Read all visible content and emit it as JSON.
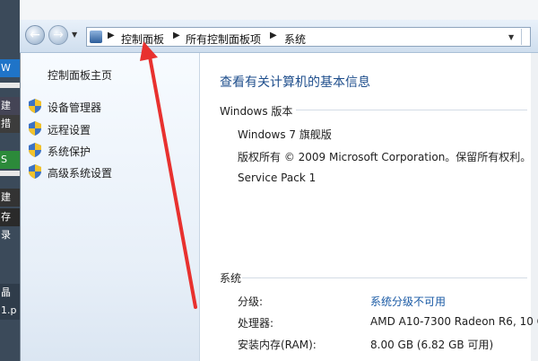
{
  "window": {
    "breadcrumb": [
      "控制面板",
      "所有控制面板项",
      "系统"
    ]
  },
  "sidebar": {
    "home": "控制面板主页",
    "links": [
      "设备管理器",
      "远程设置",
      "系统保护",
      "高级系统设置"
    ]
  },
  "main": {
    "title": "查看有关计算机的基本信息",
    "edition_heading": "Windows 版本",
    "edition": "Windows 7 旗舰版",
    "copyright": "版权所有 © 2009 Microsoft Corporation。保留所有权利。",
    "service_pack": "Service Pack 1",
    "system_heading": "系统",
    "rows": [
      {
        "label": "分级:",
        "value": "系统分级不可用"
      },
      {
        "label": "处理器:",
        "value": "AMD A10-7300 Radeon R6, 10 C"
      },
      {
        "label": "安装内存(RAM):",
        "value": "8.00 GB (6.82 GB 可用)"
      }
    ]
  },
  "desktop": {
    "fragments": [
      "W",
      "建",
      "措",
      "S",
      "建 ×",
      "存录",
      "晶示",
      "1.p"
    ]
  },
  "colors": {
    "link_blue": "#1a5aa5",
    "title_blue": "#1e4e8c",
    "arrow_red": "#e8312f"
  }
}
